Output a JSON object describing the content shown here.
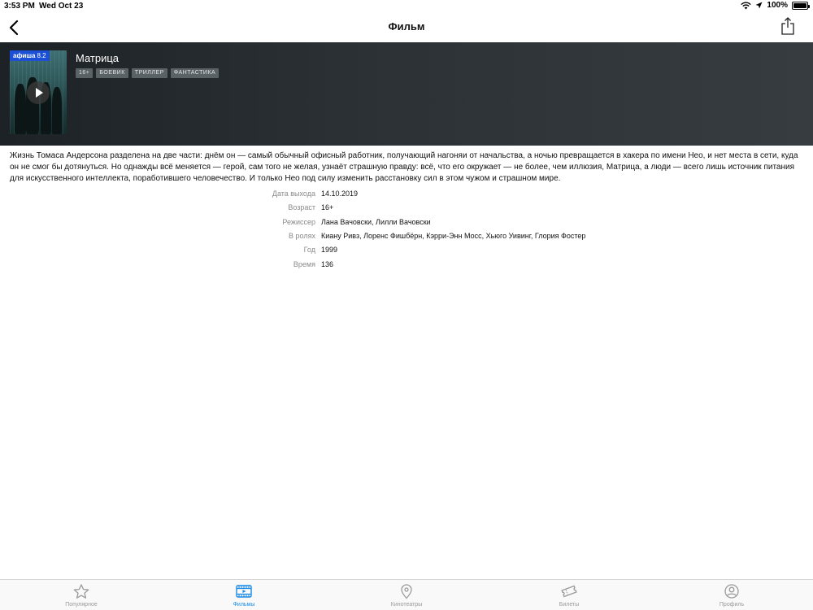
{
  "status_bar": {
    "time": "3:53 PM",
    "date": "Wed Oct 23",
    "battery_percent": "100%",
    "battery_level": 1.0
  },
  "nav": {
    "title": "Фильм"
  },
  "movie": {
    "rating_brand": "афиша",
    "rating_score": "8.2",
    "title": "Матрица",
    "tags": [
      "16+",
      "БОЕВИК",
      "ТРИЛЛЕР",
      "ФАНТАСТИКА"
    ],
    "description": "Жизнь Томаса Андерсона разделена на две части: днём он — самый обычный офисный работник, получающий нагоняи от начальства, а ночью превращается в хакера по имени Нео, и нет места в сети, куда он не смог бы дотянуться. Но однажды всё меняется — герой, сам того не желая, узнаёт страшную правду: всё, что его окружает — не более, чем иллюзия, Матрица, а люди — всего лишь источник питания для искусственного интеллекта, поработившего человечество. И только Нео под силу изменить расстановку сил в этом чужом и страшном мире."
  },
  "details": [
    {
      "label": "Дата выхода",
      "value": "14.10.2019"
    },
    {
      "label": "Возраст",
      "value": "16+"
    },
    {
      "label": "Режиссер",
      "value": "Лана Вачовски, Лилли Вачовски"
    },
    {
      "label": "В ролях",
      "value": "Киану Ривз, Лоренс Фишбёрн, Кэрри-Энн Мосс, Хьюго Уивинг, Глория Фостер"
    },
    {
      "label": "Год",
      "value": "1999"
    },
    {
      "label": "Время",
      "value": "136"
    }
  ],
  "tabs": [
    {
      "label": "Популярное",
      "icon": "star-icon",
      "active": false
    },
    {
      "label": "Фильмы",
      "icon": "film-icon",
      "active": true
    },
    {
      "label": "Кинотеатры",
      "icon": "location-pin-icon",
      "active": false
    },
    {
      "label": "Билеты",
      "icon": "ticket-icon",
      "active": false
    },
    {
      "label": "Профиль",
      "icon": "profile-icon",
      "active": false
    }
  ],
  "colors": {
    "accent": "#1a8be8",
    "rating_badge": "#1a4fd6",
    "tab_inactive": "#9a9a9a"
  }
}
